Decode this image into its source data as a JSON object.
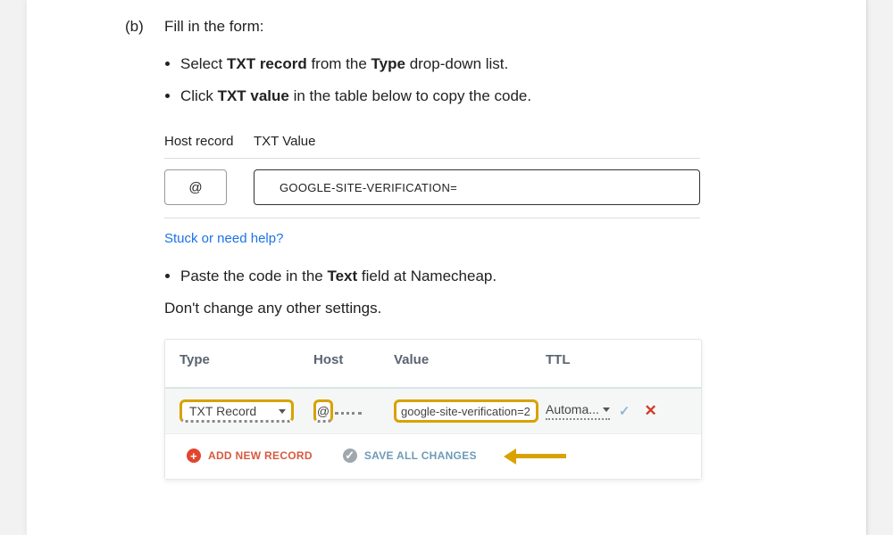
{
  "step": {
    "marker": "(b)",
    "title": "Fill in the form:"
  },
  "bullets": {
    "b1": {
      "prefix": "Select ",
      "bold1": "TXT record",
      "mid": " from the ",
      "bold2": "Type",
      "suffix": " drop-down list."
    },
    "b2": {
      "prefix": "Click ",
      "bold1": "TXT value",
      "suffix": " in the table below to copy the code."
    },
    "b3": {
      "prefix": "Paste the code in the ",
      "bold1": "Text",
      "suffix": " field at Namecheap."
    }
  },
  "mini": {
    "head_host": "Host record",
    "head_value": "TXT Value",
    "host": "@",
    "value": "GOOGLE-SITE-VERIFICATION="
  },
  "help_link": "Stuck or need help?",
  "note": "Don't change any other settings.",
  "namecheap": {
    "head": {
      "type": "Type",
      "host": "Host",
      "value": "Value",
      "ttl": "TTL"
    },
    "row": {
      "type": "TXT Record",
      "host": "@",
      "value": "google-site-verification=2",
      "ttl": "Automa..."
    },
    "actions": {
      "add": "ADD NEW RECORD",
      "save": "SAVE ALL CHANGES"
    }
  }
}
